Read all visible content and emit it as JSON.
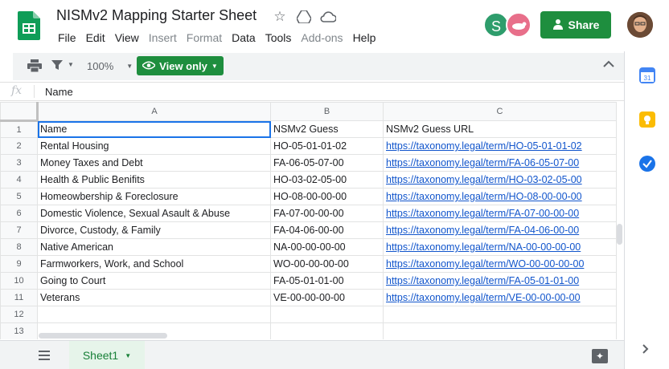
{
  "header": {
    "title": "NISMv2 Mapping Starter Sheet",
    "menu": [
      "File",
      "Edit",
      "View",
      "Insert",
      "Format",
      "Data",
      "Tools",
      "Add-ons",
      "Help"
    ],
    "menu_disabled": [
      "Insert",
      "Format",
      "Add-ons"
    ],
    "share_label": "Share",
    "collaborator_initial": "S"
  },
  "toolbar": {
    "zoom": "100%",
    "view_only_label": "View only"
  },
  "formula_bar": {
    "fx": "fx",
    "value": "Name"
  },
  "grid": {
    "columns": [
      "A",
      "B",
      "C"
    ],
    "rows": [
      {
        "n": "1",
        "a": "Name",
        "b": "NSMv2 Guess",
        "c": "NSMv2 Guess URL"
      },
      {
        "n": "2",
        "a": "Rental Housing",
        "b": "HO-05-01-01-02",
        "c": "https://taxonomy.legal/term/HO-05-01-01-02"
      },
      {
        "n": "3",
        "a": "Money Taxes and Debt",
        "b": "FA-06-05-07-00",
        "c": "https://taxonomy.legal/term/FA-06-05-07-00"
      },
      {
        "n": "4",
        "a": "Health & Public Benifits",
        "b": "HO-03-02-05-00",
        "c": "https://taxonomy.legal/term/HO-03-02-05-00"
      },
      {
        "n": "5",
        "a": "Homeowbership & Foreclosure",
        "b": "HO-08-00-00-00",
        "c": "https://taxonomy.legal/term/HO-08-00-00-00"
      },
      {
        "n": "6",
        "a": "Domestic Violence, Sexual Asault & Abuse",
        "b": "FA-07-00-00-00",
        "c": "https://taxonomy.legal/term/FA-07-00-00-00"
      },
      {
        "n": "7",
        "a": "Divorce, Custody, & Family",
        "b": "FA-04-06-00-00",
        "c": "https://taxonomy.legal/term/FA-04-06-00-00"
      },
      {
        "n": "8",
        "a": "Native American",
        "b": "NA-00-00-00-00",
        "c": "https://taxonomy.legal/term/NA-00-00-00-00"
      },
      {
        "n": "9",
        "a": "Farmworkers, Work, and School",
        "b": "WO-00-00-00-00",
        "c": "https://taxonomy.legal/term/WO-00-00-00-00"
      },
      {
        "n": "10",
        "a": "Going to Court",
        "b": "FA-05-01-01-00",
        "c": "https://taxonomy.legal/term/FA-05-01-01-00"
      },
      {
        "n": "11",
        "a": "Veterans",
        "b": "VE-00-00-00-00",
        "c": "https://taxonomy.legal/term/VE-00-00-00-00"
      },
      {
        "n": "12",
        "a": "",
        "b": "",
        "c": ""
      },
      {
        "n": "13",
        "a": "",
        "b": "",
        "c": ""
      }
    ]
  },
  "tabs": {
    "sheet_name": "Sheet1"
  },
  "colors": {
    "accent_green": "#1e8e3e",
    "link_blue": "#1155cc",
    "selection_blue": "#1a73e8"
  }
}
